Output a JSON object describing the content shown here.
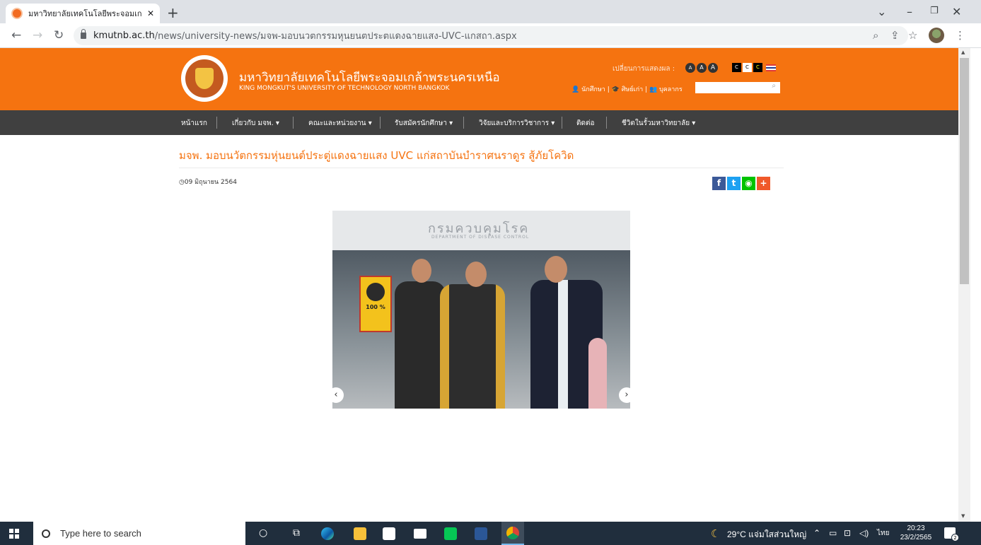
{
  "browser": {
    "tab_title": "มหาวิทยาลัยเทคโนโลยีพระจอมเกล้าพระ",
    "tab_close": "✕",
    "new_tab": "+",
    "url_host": "kmutnb.ac.th",
    "url_path": "/news/university-news/มจพ-มอบนวตกรรมหุนยนตประตแดงฉายแสง-UVC-แกสถา.aspx"
  },
  "site": {
    "name_th": "มหาวิทยาลัยเทคโนโลยีพระจอมเกล้าพระนครเหนือ",
    "name_en": "KING MONGKUT'S UNIVERSITY OF TECHNOLOGY NORTH BANGKOK",
    "display_label": "เปลี่ยนการแสดงผล :",
    "font_sizes": [
      "A",
      "A",
      "A"
    ],
    "contrast": [
      "C",
      "C",
      "C"
    ],
    "links": [
      "นักศึกษา",
      "ศิษย์เก่า",
      "บุคลากร"
    ]
  },
  "nav": {
    "items": [
      {
        "label": "หน้าแรก"
      },
      {
        "label": "เกี่ยวกับ มจพ.  ▾"
      },
      {
        "label": "คณะและหน่วยงาน  ▾"
      },
      {
        "label": "รับสมัครนักศึกษา  ▾"
      },
      {
        "label": "วิจัยและบริการวิชาการ  ▾"
      },
      {
        "label": "ติดต่อ"
      },
      {
        "label": "ชีวิตในรั้วมหาวิทยาลัย  ▾"
      }
    ]
  },
  "article": {
    "title": "มจพ. มอบนวัตกรรมหุ่นยนต์ประตู่แดงฉายแสง UVC แก่สถาบันบำราศนราดูร สู้ภัยโควิด",
    "date": "09 มิถุนายน 2564",
    "photo_sign_th": "กรมควบคุมโรค",
    "photo_sign_en": "DEPARTMENT OF DISEASE CONTROL",
    "poster_text": "100 %"
  },
  "share": [
    "f",
    "t",
    "◉",
    "+"
  ],
  "taskbar": {
    "search_placeholder": "Type here to search",
    "weather": "29°C  แจ่มใสส่วนใหญ่",
    "lang": "ไทย",
    "time": "20:23",
    "date": "23/2/2565",
    "notif_count": "2"
  },
  "colors": {
    "brand_orange": "#f57310",
    "nav_dark": "#404040",
    "taskbar": "#202e3d"
  }
}
